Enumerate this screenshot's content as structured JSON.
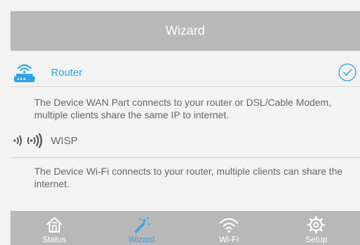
{
  "header": {
    "title": "Wizard"
  },
  "options": [
    {
      "label": "Router",
      "icon": "router-icon",
      "selected": true,
      "description": "The Device WAN Part connects to your router or DSL/Cable Modem, multiple clients share the same IP to internet."
    },
    {
      "label": "WISP",
      "icon": "wireless-signal-icon",
      "selected": false,
      "description": "The Device Wi-Fi connects to your router, multiple clients can share the internet."
    }
  ],
  "tabs": [
    {
      "label": "Status",
      "icon": "home-icon",
      "active": false
    },
    {
      "label": "Wizard",
      "icon": "magic-wand-icon",
      "active": true
    },
    {
      "label": "Wi-Fi",
      "icon": "wifi-icon",
      "active": false
    },
    {
      "label": "Setup",
      "icon": "gear-icon",
      "active": false
    }
  ],
  "colors": {
    "accent": "#2ea3e8",
    "header_bg": "#b8b8b8",
    "page_bg": "#f3f3f3",
    "text_gray": "#666666"
  }
}
